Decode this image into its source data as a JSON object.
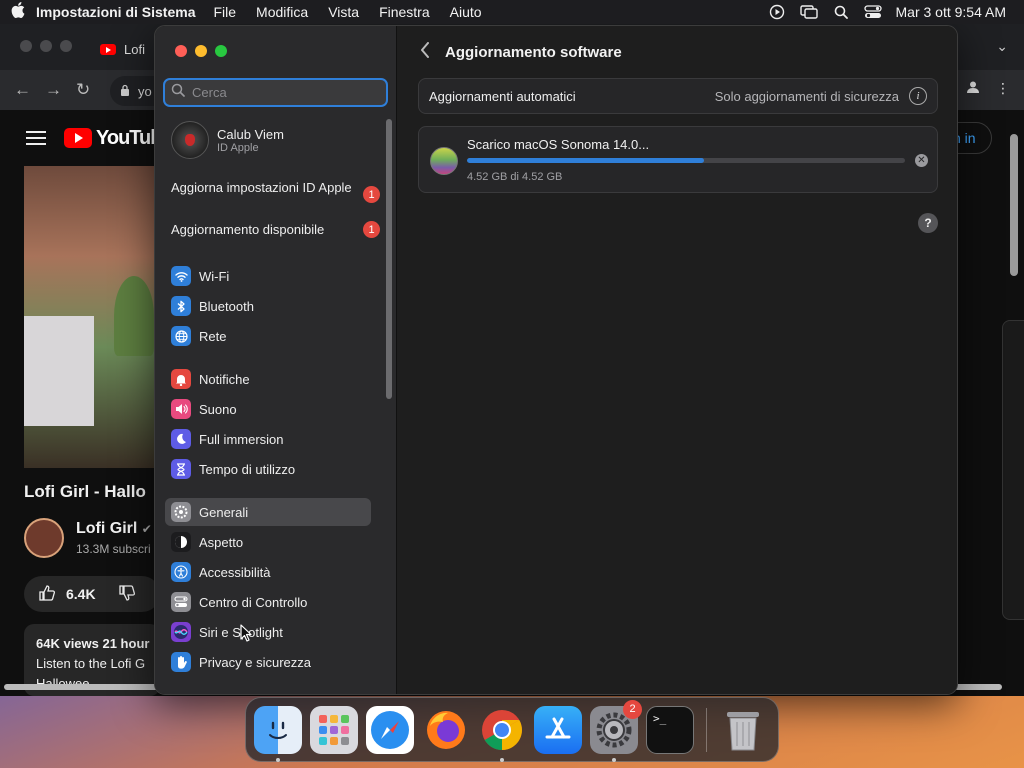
{
  "menubar": {
    "app_name": "Impostazioni di Sistema",
    "menus": [
      "File",
      "Modifica",
      "Vista",
      "Finestra",
      "Aiuto"
    ],
    "clock": "Mar 3 ott  9:54 AM"
  },
  "browser": {
    "tab_title": "Lofi",
    "url_text": "yo",
    "youtube": {
      "logo_text": "YouTub",
      "signin_text": "n in",
      "video_title": "Lofi Girl - Hallo",
      "channel_name": "Lofi Girl",
      "subscribers": "13.3M subscri",
      "likes": "6.4K",
      "views_line": "64K views  21 hour",
      "desc_line": "Listen to the Lofi G",
      "desc_line2": "Hallowee"
    }
  },
  "settings": {
    "search_placeholder": "Cerca",
    "account": {
      "name": "Calub Viem",
      "subtitle": "ID Apple"
    },
    "notices": [
      {
        "label": "Aggiorna impostazioni ID Apple",
        "badge": "1"
      },
      {
        "label": "Aggiornamento disponibile",
        "badge": "1"
      }
    ],
    "sidebar_groups": [
      [
        {
          "label": "Wi-Fi",
          "icon": "wifi-icon",
          "color": "#2f7fd9"
        },
        {
          "label": "Bluetooth",
          "icon": "bluetooth-icon",
          "color": "#2f7fd9"
        },
        {
          "label": "Rete",
          "icon": "globe-icon",
          "color": "#2f7fd9"
        }
      ],
      [
        {
          "label": "Notifiche",
          "icon": "bell-icon",
          "color": "#e5483f"
        },
        {
          "label": "Suono",
          "icon": "speaker-icon",
          "color": "#e84a7f"
        },
        {
          "label": "Full immersion",
          "icon": "moon-icon",
          "color": "#5e5ce6"
        },
        {
          "label": "Tempo di utilizzo",
          "icon": "hourglass-icon",
          "color": "#5e5ce6"
        }
      ],
      [
        {
          "label": "Generali",
          "icon": "gear-icon",
          "color": "#8e8e93",
          "selected": true
        },
        {
          "label": "Aspetto",
          "icon": "appearance-icon",
          "color": "#1c1c1e"
        },
        {
          "label": "Accessibilità",
          "icon": "accessibility-icon",
          "color": "#2f7fd9"
        },
        {
          "label": "Centro di Controllo",
          "icon": "control-center-icon",
          "color": "#8e8e93"
        },
        {
          "label": "Siri e Spotlight",
          "icon": "siri-icon",
          "color": "#7a3fd0"
        },
        {
          "label": "Privacy e sicurezza",
          "icon": "hand-icon",
          "color": "#2f7fd9"
        }
      ]
    ],
    "main": {
      "title": "Aggiornamento software",
      "auto_updates_label": "Aggiornamenti automatici",
      "auto_updates_value": "Solo aggiornamenti di sicurezza",
      "download": {
        "title": "Scarico macOS Sonoma 14.0...",
        "size_text": "4.52 GB di 4.52 GB",
        "progress": 0.54
      }
    }
  },
  "dock": {
    "apps": [
      {
        "name": "finder",
        "running": true
      },
      {
        "name": "launchpad",
        "running": false
      },
      {
        "name": "safari",
        "running": false
      },
      {
        "name": "firefox",
        "running": false
      },
      {
        "name": "chrome",
        "running": true
      },
      {
        "name": "app-store",
        "running": false
      },
      {
        "name": "system-settings",
        "running": true,
        "badge": "2"
      },
      {
        "name": "terminal",
        "running": false
      }
    ],
    "trash": "trash"
  },
  "colors": {
    "accent": "#2f7fd9",
    "badge": "#e5483f",
    "window_bg": "#1e1e1e",
    "sidebar_bg": "#2a2a2c"
  }
}
